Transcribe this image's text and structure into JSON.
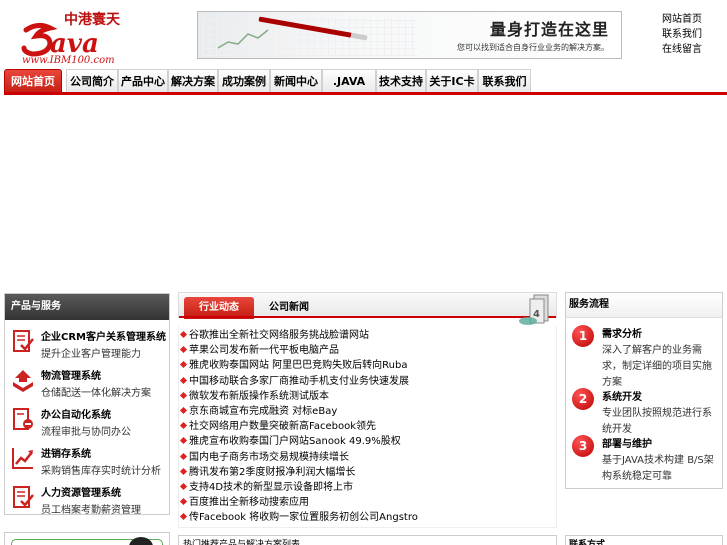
{
  "header": {
    "logo_text": "中港寰天 Java www.IBM100.com",
    "banner": {
      "slogan": "量身打造在这里",
      "subtitle": "您可以找到适合自身行业业务的解决方案。"
    },
    "top_links": [
      "网站首页",
      "联系我们",
      "在线留言"
    ]
  },
  "nav": {
    "items": [
      "网站首页",
      "公司简介",
      "产品中心",
      "解决方案",
      "成功案例",
      "新闻中心",
      ".JAVA",
      "技术支持",
      "关于IC卡",
      "联系我们"
    ],
    "active_index": 0,
    "accent_color": "#cc0000"
  },
  "left_panel": {
    "title": "产品与服务",
    "items": [
      {
        "title": "企业CRM客户关系管理系统",
        "subtitle": "提升企业客户管理能力",
        "icon": "document-check-icon"
      },
      {
        "title": "物流管理系统",
        "subtitle": "仓储配送一体化解决方案",
        "icon": "box-arrow-icon"
      },
      {
        "title": "办公自动化系统",
        "subtitle": "流程审批与协同办公",
        "icon": "document-minus-icon"
      },
      {
        "title": "进销存系统",
        "subtitle": "采购销售库存实时统计分析",
        "icon": "chart-trend-icon"
      },
      {
        "title": "人力资源管理系统",
        "subtitle": "员工档案考勤薪资管理",
        "icon": "document-check-icon"
      }
    ]
  },
  "news_panel": {
    "tabs": [
      "行业动态",
      "公司新闻"
    ],
    "items": [
      "谷歌推出全新社交网络服务挑战脸谱网站",
      "苹果公司发布新一代平板电脑产品",
      "雅虎收购泰国网站 阿里巴巴竞购失败后转向Ruba",
      "中国移动联合多家厂商推动手机支付业务快速发展",
      "微软发布新版操作系统测试版本",
      "京东商城宣布完成融资 对标eBay",
      "社交网络用户数量突破新高Facebook领先",
      "雅虎宣布收购泰国门户网站Sanook 49.9%股权",
      "国内电子商务市场交易规模持续增长",
      "腾讯发布第2季度财报净利润大幅增长",
      "支持4D技术的新型显示设备即将上市",
      "百度推出全新移动搜索应用",
      "传Facebook 将收购一家位置服务初创公司Angstro"
    ]
  },
  "right_panel": {
    "title": "服务流程",
    "steps": [
      {
        "num": "1",
        "title": "需求分析",
        "desc": "深入了解客户的业务需求，制定详细的项目实施方案"
      },
      {
        "num": "2",
        "title": "系统开发",
        "desc": "专业团队按照规范进行系统开发"
      },
      {
        "num": "3",
        "title": "部署与维护",
        "desc": "基于JAVA技术构建 B/S架构系统稳定可靠"
      }
    ]
  },
  "bottom": {
    "middle_title": "热门推荐产品与解决方案列表",
    "right_title": "联系方式"
  }
}
